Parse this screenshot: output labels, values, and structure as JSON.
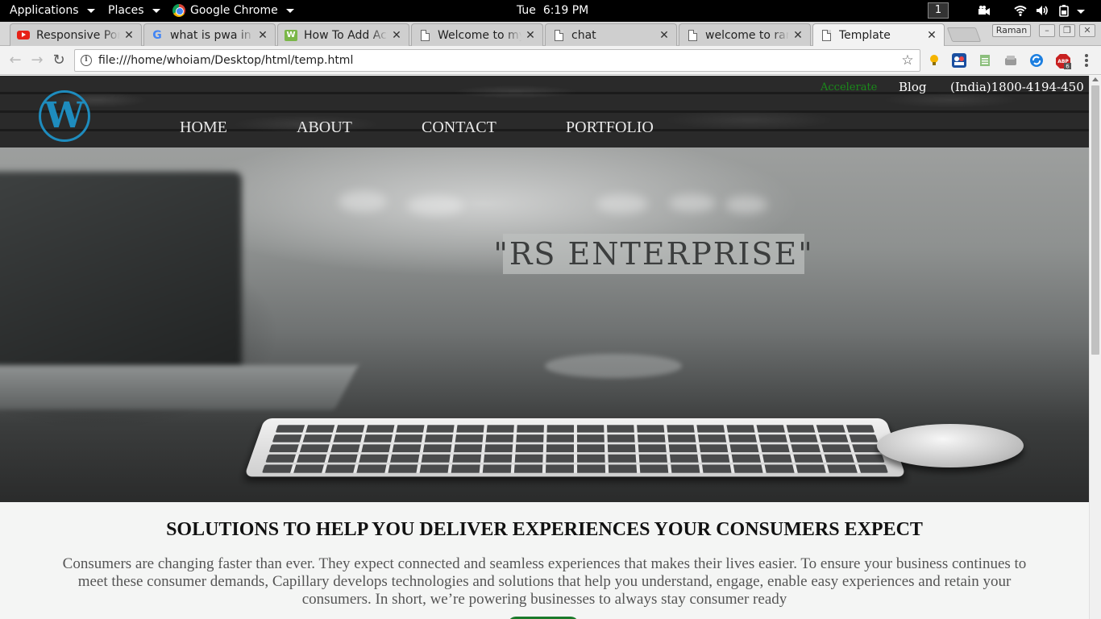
{
  "gnome_bar": {
    "applications": "Applications",
    "places": "Places",
    "active_app": "Google Chrome",
    "clock": "Tue  6:19 PM",
    "workspace": "1"
  },
  "browser": {
    "tabs": [
      {
        "title": "Responsive Portfolio",
        "favicon": "youtube-icon"
      },
      {
        "title": "what is pwa in android",
        "favicon": "google-icon"
      },
      {
        "title": "How To Add Action",
        "favicon": "w3-icon"
      },
      {
        "title": "Welcome to my site",
        "favicon": "document-icon"
      },
      {
        "title": "chat",
        "favicon": "document-icon"
      },
      {
        "title": "welcome to raman",
        "favicon": "document-icon"
      },
      {
        "title": "Template",
        "favicon": "document-icon",
        "active": true
      }
    ],
    "profile_name": "Raman",
    "url": "file:///home/whoiam/Desktop/html/temp.html",
    "extension_badge": "6"
  },
  "site": {
    "top_links": {
      "accelerate": "Accelerate",
      "blog": "Blog",
      "phone": "(India)1800-4194-450"
    },
    "nav": [
      "HOME",
      "ABOUT",
      "CONTACT",
      "PORTFOLIO"
    ],
    "logo_letter": "W",
    "brand": "\"RS ENTERPRISE\"",
    "section_title": "SOLUTIONS TO HELP YOU DELIVER EXPERIENCES YOUR CONSUMERS EXPECT",
    "section_body": "Consumers are changing faster than ever. They expect connected and seamless experiences that makes their lives easier. To ensure your business continues to meet these consumer demands, Capillary develops technologies and solutions that help you understand, engage, enable easy experiences and retain your consumers. In short, we’re powering businesses to always stay consumer ready"
  },
  "colors": {
    "wp_blue": "#1e8cbe",
    "accelerate_green": "#1a8a1a",
    "cta_green": "#1a7a2a"
  }
}
